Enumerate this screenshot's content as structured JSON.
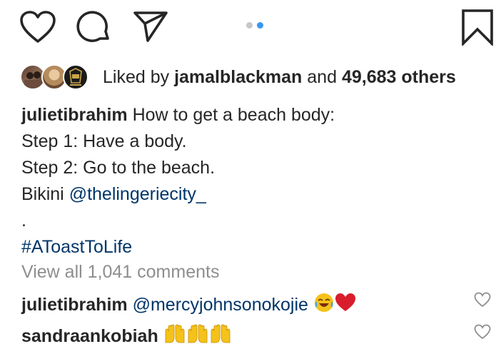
{
  "carousel": {
    "count": 2,
    "active_index": 1
  },
  "likes": {
    "prefix": "Liked by ",
    "user": "jamalblackman",
    "middle": " and ",
    "count_text": "49,683 others"
  },
  "caption": {
    "username": "julietibrahim",
    "lines": [
      "How to get a beach body:",
      "Step 1: Have a body.",
      "Step 2: Go to the beach.",
      "Bikini "
    ],
    "mention": "@thelingeriecity_",
    "dot_line": ".",
    "hashtag": "#AToastToLife"
  },
  "view_all": "View all 1,041 comments",
  "comments": [
    {
      "username": "julietibrahim",
      "text": "@mercyjohnsonokojie",
      "emojis": [
        "face-with-tears-of-joy",
        "red-heart"
      ]
    },
    {
      "username": "sandraankobiah",
      "text": "",
      "emojis": [
        "raising-hands",
        "raising-hands",
        "raising-hands"
      ]
    }
  ],
  "colors": {
    "link": "#003569",
    "muted": "#8e8e8e",
    "active_dot": "#3897f0",
    "heart_red": "#d81e2c",
    "emoji_yellow": "#f5c21b"
  }
}
